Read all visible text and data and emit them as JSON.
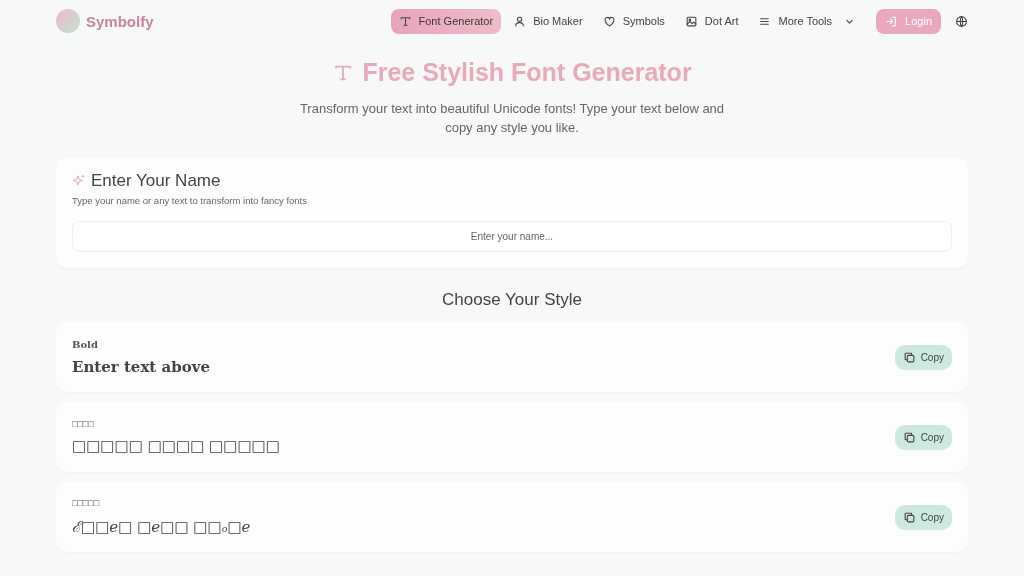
{
  "brand": {
    "name": "Symbolfy"
  },
  "nav": [
    {
      "label": "Font Generator",
      "kind": "text",
      "selected": true
    },
    {
      "label": "Bio Maker",
      "kind": "user",
      "selected": false
    },
    {
      "label": "Symbols",
      "kind": "heart",
      "selected": false
    },
    {
      "label": "Dot Art",
      "kind": "image",
      "selected": false
    },
    {
      "label": "More Tools",
      "kind": "menu",
      "selected": false,
      "dropdown": true
    }
  ],
  "login": {
    "label": "Login"
  },
  "hero": {
    "title": "Free Stylish Font Generator",
    "subtitle": "Transform your text into beautiful Unicode fonts! Type your text below and copy any style you like."
  },
  "input_card": {
    "title": "Enter Your Name",
    "description": "Type your name or any text to transform into fancy fonts",
    "placeholder": "Enter your name..."
  },
  "styles_heading": "Choose Your Style",
  "styles": [
    {
      "name": "Bold",
      "kind": "serif-bold",
      "preview": "Enter text above",
      "copy": "Copy"
    },
    {
      "name": "□□□□",
      "kind": "boxes",
      "preview": "□□□□□ □□□□ □□□□□",
      "copy": "Copy"
    },
    {
      "name": "□□□□□",
      "kind": "script",
      "preview": "ℰ□□e□ □e□□ □□ₒ□e",
      "copy": "Copy"
    }
  ]
}
